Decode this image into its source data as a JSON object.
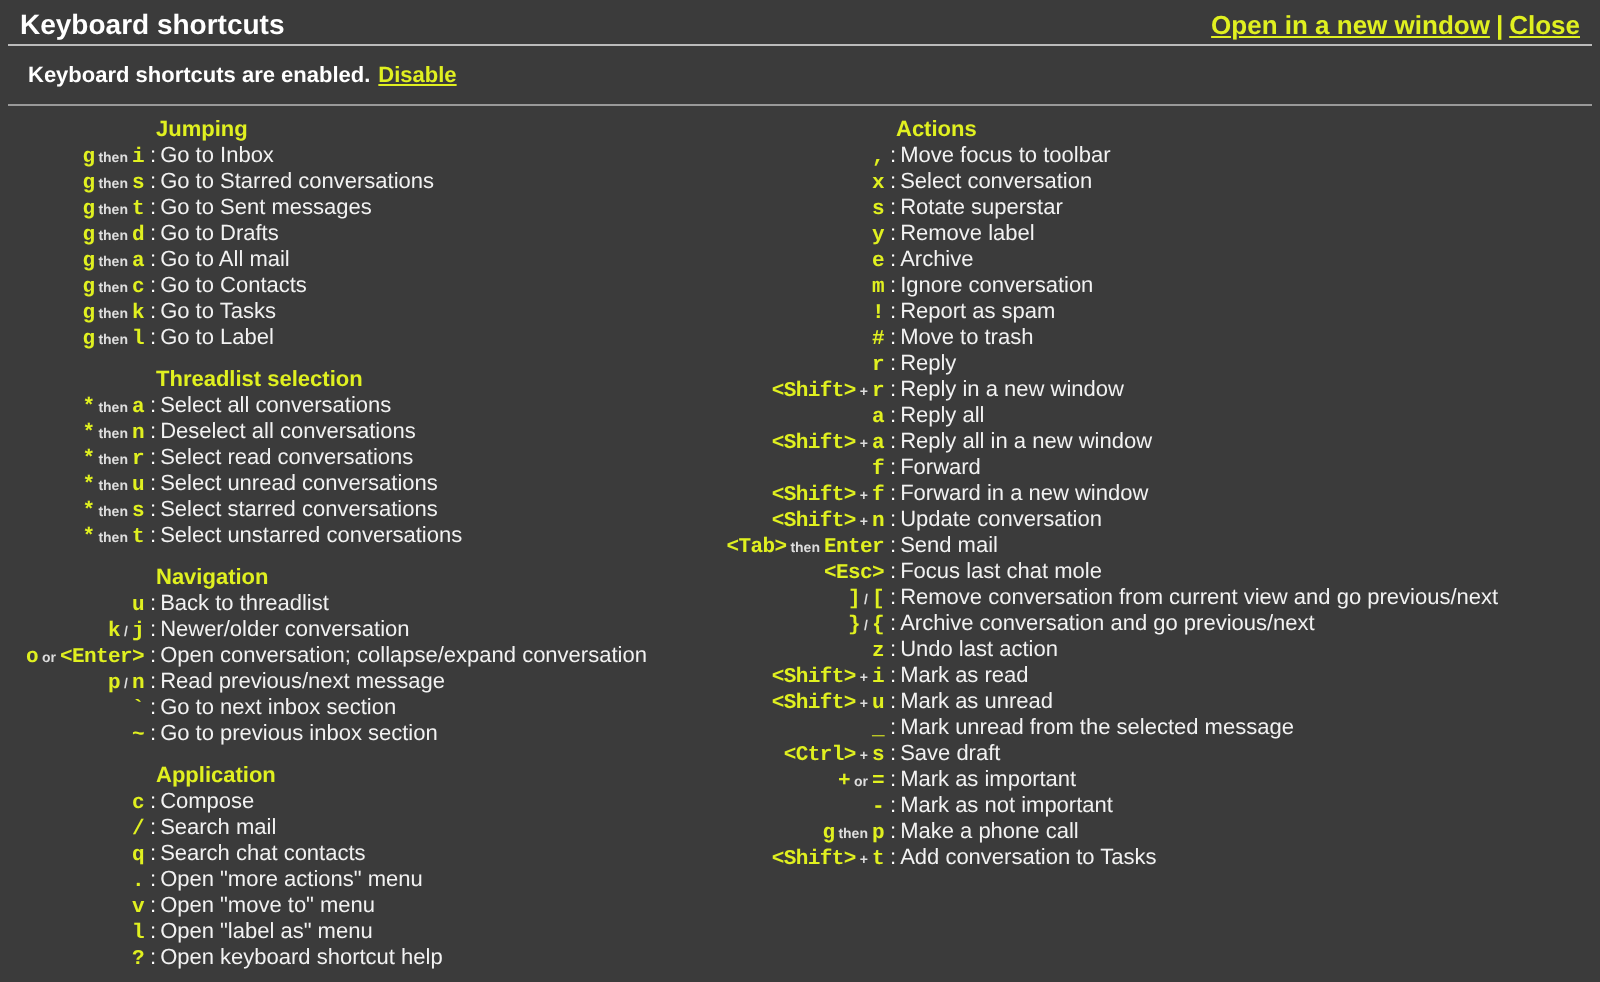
{
  "header": {
    "title": "Keyboard shortcuts",
    "links": [
      "Open in a new window",
      "Close"
    ],
    "separator": "|"
  },
  "description_separator": ":",
  "status": {
    "text": "Keyboard shortcuts are enabled.",
    "link": "Disable"
  },
  "columns": [
    {
      "sections": [
        {
          "heading": "Jumping",
          "shortcuts": [
            {
              "keys": [
                {
                  "kind": "key",
                  "text": "g"
                },
                {
                  "kind": "sep",
                  "text": "then"
                },
                {
                  "kind": "key",
                  "text": "i"
                }
              ],
              "description": "Go to Inbox"
            },
            {
              "keys": [
                {
                  "kind": "key",
                  "text": "g"
                },
                {
                  "kind": "sep",
                  "text": "then"
                },
                {
                  "kind": "key",
                  "text": "s"
                }
              ],
              "description": "Go to Starred conversations"
            },
            {
              "keys": [
                {
                  "kind": "key",
                  "text": "g"
                },
                {
                  "kind": "sep",
                  "text": "then"
                },
                {
                  "kind": "key",
                  "text": "t"
                }
              ],
              "description": "Go to Sent messages"
            },
            {
              "keys": [
                {
                  "kind": "key",
                  "text": "g"
                },
                {
                  "kind": "sep",
                  "text": "then"
                },
                {
                  "kind": "key",
                  "text": "d"
                }
              ],
              "description": "Go to Drafts"
            },
            {
              "keys": [
                {
                  "kind": "key",
                  "text": "g"
                },
                {
                  "kind": "sep",
                  "text": "then"
                },
                {
                  "kind": "key",
                  "text": "a"
                }
              ],
              "description": "Go to All mail"
            },
            {
              "keys": [
                {
                  "kind": "key",
                  "text": "g"
                },
                {
                  "kind": "sep",
                  "text": "then"
                },
                {
                  "kind": "key",
                  "text": "c"
                }
              ],
              "description": "Go to Contacts"
            },
            {
              "keys": [
                {
                  "kind": "key",
                  "text": "g"
                },
                {
                  "kind": "sep",
                  "text": "then"
                },
                {
                  "kind": "key",
                  "text": "k"
                }
              ],
              "description": "Go to Tasks"
            },
            {
              "keys": [
                {
                  "kind": "key",
                  "text": "g"
                },
                {
                  "kind": "sep",
                  "text": "then"
                },
                {
                  "kind": "key",
                  "text": "l"
                }
              ],
              "description": "Go to Label"
            }
          ]
        },
        {
          "heading": "Threadlist selection",
          "shortcuts": [
            {
              "keys": [
                {
                  "kind": "key",
                  "text": "*"
                },
                {
                  "kind": "sep",
                  "text": "then"
                },
                {
                  "kind": "key",
                  "text": "a"
                }
              ],
              "description": "Select all conversations"
            },
            {
              "keys": [
                {
                  "kind": "key",
                  "text": "*"
                },
                {
                  "kind": "sep",
                  "text": "then"
                },
                {
                  "kind": "key",
                  "text": "n"
                }
              ],
              "description": "Deselect all conversations"
            },
            {
              "keys": [
                {
                  "kind": "key",
                  "text": "*"
                },
                {
                  "kind": "sep",
                  "text": "then"
                },
                {
                  "kind": "key",
                  "text": "r"
                }
              ],
              "description": "Select read conversations"
            },
            {
              "keys": [
                {
                  "kind": "key",
                  "text": "*"
                },
                {
                  "kind": "sep",
                  "text": "then"
                },
                {
                  "kind": "key",
                  "text": "u"
                }
              ],
              "description": "Select unread conversations"
            },
            {
              "keys": [
                {
                  "kind": "key",
                  "text": "*"
                },
                {
                  "kind": "sep",
                  "text": "then"
                },
                {
                  "kind": "key",
                  "text": "s"
                }
              ],
              "description": "Select starred conversations"
            },
            {
              "keys": [
                {
                  "kind": "key",
                  "text": "*"
                },
                {
                  "kind": "sep",
                  "text": "then"
                },
                {
                  "kind": "key",
                  "text": "t"
                }
              ],
              "description": "Select unstarred conversations"
            }
          ]
        },
        {
          "heading": "Navigation",
          "shortcuts": [
            {
              "keys": [
                {
                  "kind": "key",
                  "text": "u"
                }
              ],
              "description": "Back to threadlist"
            },
            {
              "keys": [
                {
                  "kind": "key",
                  "text": "k"
                },
                {
                  "kind": "sep",
                  "text": "/"
                },
                {
                  "kind": "key",
                  "text": "j"
                }
              ],
              "description": "Newer/older conversation"
            },
            {
              "keys": [
                {
                  "kind": "key",
                  "text": "o"
                },
                {
                  "kind": "sep",
                  "text": "or"
                },
                {
                  "kind": "key",
                  "text": "<Enter>"
                }
              ],
              "description": "Open conversation; collapse/expand conversation"
            },
            {
              "keys": [
                {
                  "kind": "key",
                  "text": "p"
                },
                {
                  "kind": "sep",
                  "text": "/"
                },
                {
                  "kind": "key",
                  "text": "n"
                }
              ],
              "description": "Read previous/next message"
            },
            {
              "keys": [
                {
                  "kind": "key",
                  "text": "`"
                }
              ],
              "description": "Go to next inbox section"
            },
            {
              "keys": [
                {
                  "kind": "key",
                  "text": "~"
                }
              ],
              "description": "Go to previous inbox section"
            }
          ]
        },
        {
          "heading": "Application",
          "shortcuts": [
            {
              "keys": [
                {
                  "kind": "key",
                  "text": "c"
                }
              ],
              "description": "Compose"
            },
            {
              "keys": [
                {
                  "kind": "key",
                  "text": "/"
                }
              ],
              "description": "Search mail"
            },
            {
              "keys": [
                {
                  "kind": "key",
                  "text": "q"
                }
              ],
              "description": "Search chat contacts"
            },
            {
              "keys": [
                {
                  "kind": "key",
                  "text": "."
                }
              ],
              "description": "Open \"more actions\" menu"
            },
            {
              "keys": [
                {
                  "kind": "key",
                  "text": "v"
                }
              ],
              "description": "Open \"move to\" menu"
            },
            {
              "keys": [
                {
                  "kind": "key",
                  "text": "l"
                }
              ],
              "description": "Open \"label as\" menu"
            },
            {
              "keys": [
                {
                  "kind": "key",
                  "text": "?"
                }
              ],
              "description": "Open keyboard shortcut help"
            }
          ]
        }
      ]
    },
    {
      "sections": [
        {
          "heading": "Actions",
          "shortcuts": [
            {
              "keys": [
                {
                  "kind": "key",
                  "text": ","
                }
              ],
              "description": "Move focus to toolbar"
            },
            {
              "keys": [
                {
                  "kind": "key",
                  "text": "x"
                }
              ],
              "description": "Select conversation"
            },
            {
              "keys": [
                {
                  "kind": "key",
                  "text": "s"
                }
              ],
              "description": "Rotate superstar"
            },
            {
              "keys": [
                {
                  "kind": "key",
                  "text": "y"
                }
              ],
              "description": "Remove label"
            },
            {
              "keys": [
                {
                  "kind": "key",
                  "text": "e"
                }
              ],
              "description": "Archive"
            },
            {
              "keys": [
                {
                  "kind": "key",
                  "text": "m"
                }
              ],
              "description": "Ignore conversation"
            },
            {
              "keys": [
                {
                  "kind": "key",
                  "text": "!"
                }
              ],
              "description": "Report as spam"
            },
            {
              "keys": [
                {
                  "kind": "key",
                  "text": "#"
                }
              ],
              "description": "Move to trash"
            },
            {
              "keys": [
                {
                  "kind": "key",
                  "text": "r"
                }
              ],
              "description": "Reply"
            },
            {
              "keys": [
                {
                  "kind": "key",
                  "text": "<Shift>"
                },
                {
                  "kind": "sep",
                  "text": "+"
                },
                {
                  "kind": "key",
                  "text": "r"
                }
              ],
              "description": "Reply in a new window"
            },
            {
              "keys": [
                {
                  "kind": "key",
                  "text": "a"
                }
              ],
              "description": "Reply all"
            },
            {
              "keys": [
                {
                  "kind": "key",
                  "text": "<Shift>"
                },
                {
                  "kind": "sep",
                  "text": "+"
                },
                {
                  "kind": "key",
                  "text": "a"
                }
              ],
              "description": "Reply all in a new window"
            },
            {
              "keys": [
                {
                  "kind": "key",
                  "text": "f"
                }
              ],
              "description": "Forward"
            },
            {
              "keys": [
                {
                  "kind": "key",
                  "text": "<Shift>"
                },
                {
                  "kind": "sep",
                  "text": "+"
                },
                {
                  "kind": "key",
                  "text": "f"
                }
              ],
              "description": "Forward in a new window"
            },
            {
              "keys": [
                {
                  "kind": "key",
                  "text": "<Shift>"
                },
                {
                  "kind": "sep",
                  "text": "+"
                },
                {
                  "kind": "key",
                  "text": "n"
                }
              ],
              "description": "Update conversation"
            },
            {
              "keys": [
                {
                  "kind": "key",
                  "text": "<Tab>"
                },
                {
                  "kind": "sep",
                  "text": "then"
                },
                {
                  "kind": "key",
                  "text": "Enter"
                }
              ],
              "description": "Send mail"
            },
            {
              "keys": [
                {
                  "kind": "key",
                  "text": "<Esc>"
                }
              ],
              "description": "Focus last chat mole"
            },
            {
              "keys": [
                {
                  "kind": "key",
                  "text": "]"
                },
                {
                  "kind": "sep",
                  "text": "/"
                },
                {
                  "kind": "key",
                  "text": "["
                }
              ],
              "description": "Remove conversation from current view and go previous/next"
            },
            {
              "keys": [
                {
                  "kind": "key",
                  "text": "}"
                },
                {
                  "kind": "sep",
                  "text": "/"
                },
                {
                  "kind": "key",
                  "text": "{"
                }
              ],
              "description": "Archive conversation and go previous/next"
            },
            {
              "keys": [
                {
                  "kind": "key",
                  "text": "z"
                }
              ],
              "description": "Undo last action"
            },
            {
              "keys": [
                {
                  "kind": "key",
                  "text": "<Shift>"
                },
                {
                  "kind": "sep",
                  "text": "+"
                },
                {
                  "kind": "key",
                  "text": "i"
                }
              ],
              "description": "Mark as read"
            },
            {
              "keys": [
                {
                  "kind": "key",
                  "text": "<Shift>"
                },
                {
                  "kind": "sep",
                  "text": "+"
                },
                {
                  "kind": "key",
                  "text": "u"
                }
              ],
              "description": "Mark as unread"
            },
            {
              "keys": [
                {
                  "kind": "key",
                  "text": "_"
                }
              ],
              "description": "Mark unread from the selected message"
            },
            {
              "keys": [
                {
                  "kind": "key",
                  "text": "<Ctrl>"
                },
                {
                  "kind": "sep",
                  "text": "+"
                },
                {
                  "kind": "key",
                  "text": "s"
                }
              ],
              "description": "Save draft"
            },
            {
              "keys": [
                {
                  "kind": "key",
                  "text": "+"
                },
                {
                  "kind": "sep",
                  "text": "or"
                },
                {
                  "kind": "key",
                  "text": "="
                }
              ],
              "description": "Mark as important"
            },
            {
              "keys": [
                {
                  "kind": "key",
                  "text": "-"
                }
              ],
              "description": "Mark as not important"
            },
            {
              "keys": [
                {
                  "kind": "key",
                  "text": "g"
                },
                {
                  "kind": "sep",
                  "text": "then"
                },
                {
                  "kind": "key",
                  "text": "p"
                }
              ],
              "description": "Make a phone call"
            },
            {
              "keys": [
                {
                  "kind": "key",
                  "text": "<Shift>"
                },
                {
                  "kind": "sep",
                  "text": "+"
                },
                {
                  "kind": "key",
                  "text": "t"
                }
              ],
              "description": "Add conversation to Tasks"
            }
          ]
        }
      ]
    }
  ]
}
